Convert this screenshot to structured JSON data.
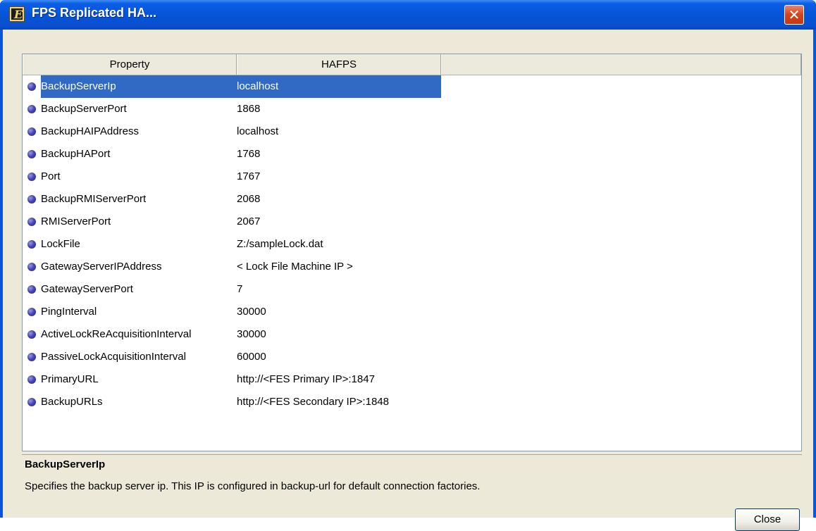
{
  "window": {
    "title": "FPS Replicated HA...",
    "close_glyph": "✕"
  },
  "table": {
    "columns": [
      "Property",
      "HAFPS",
      ""
    ],
    "rows": [
      {
        "property": "BackupServerIp",
        "value": "localhost",
        "selected": true
      },
      {
        "property": "BackupServerPort",
        "value": "1868"
      },
      {
        "property": "BackupHAIPAddress",
        "value": "localhost"
      },
      {
        "property": "BackupHAPort",
        "value": "1768"
      },
      {
        "property": "Port",
        "value": "1767"
      },
      {
        "property": "BackupRMIServerPort",
        "value": "2068"
      },
      {
        "property": "RMIServerPort",
        "value": "2067"
      },
      {
        "property": "LockFile",
        "value": "Z:/sampleLock.dat"
      },
      {
        "property": "GatewayServerIPAddress",
        "value": "< Lock File Machine IP >"
      },
      {
        "property": "GatewayServerPort",
        "value": "7"
      },
      {
        "property": "PingInterval",
        "value": "30000"
      },
      {
        "property": "ActiveLockReAcquisitionInterval",
        "value": "30000"
      },
      {
        "property": "PassiveLockAcquisitionInterval",
        "value": "60000"
      },
      {
        "property": "PrimaryURL",
        "value": "http://<FES Primary IP>:1847"
      },
      {
        "property": "BackupURLs",
        "value": "http://<FES Secondary IP>:1848"
      }
    ]
  },
  "description": {
    "title": "BackupServerIp",
    "text": "Specifies the backup server ip. This IP is configured in backup-url for default connection factories."
  },
  "buttons": {
    "close": "Close"
  },
  "colors": {
    "titlebar": "#0553d6",
    "selection": "#316ac5",
    "dialog_bg": "#ece9d8"
  }
}
